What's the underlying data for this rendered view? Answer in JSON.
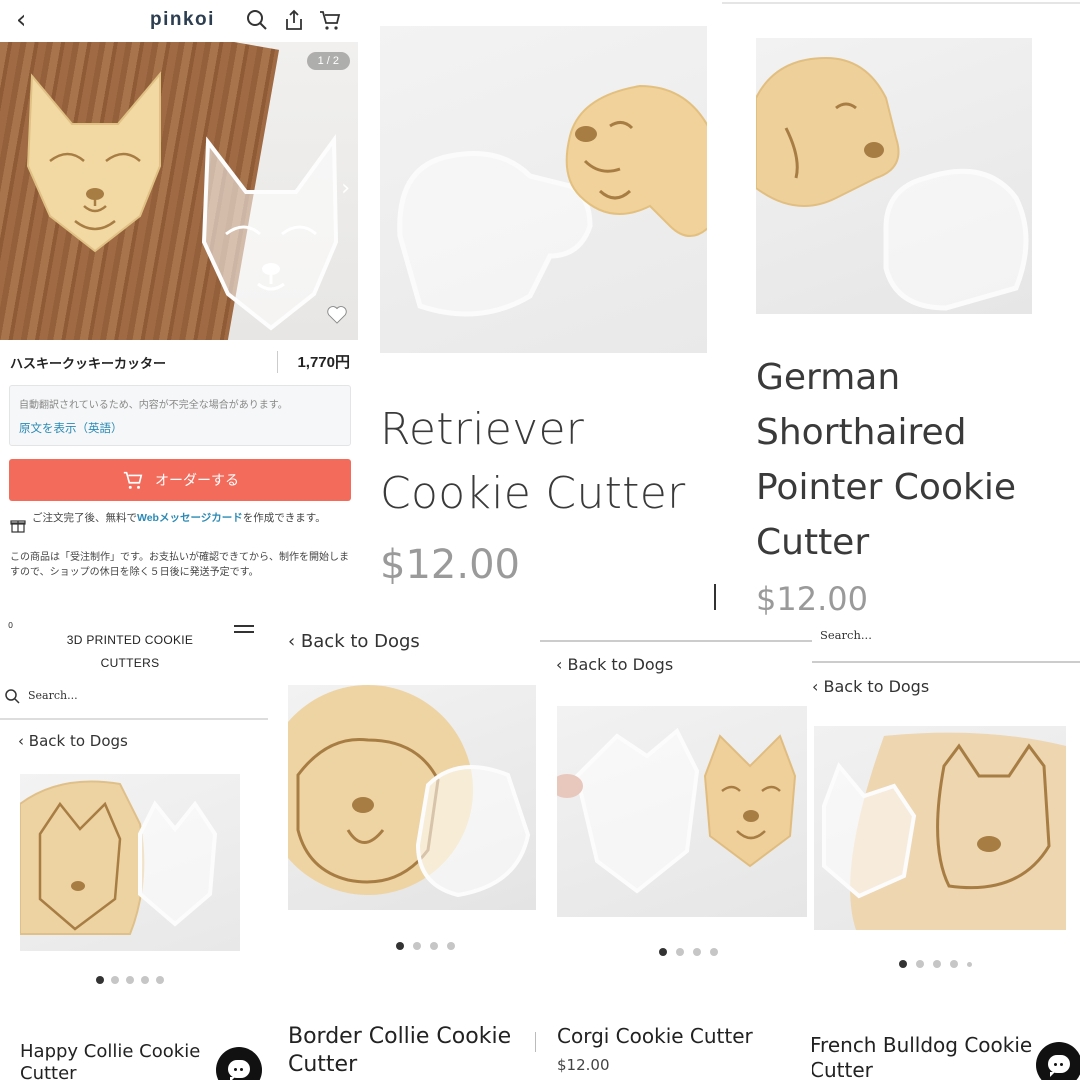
{
  "pinkoi": {
    "back_glyph": "‹",
    "logo": "pinkoi",
    "image_counter": "1 / 2",
    "product_title": "ハスキークッキーカッター",
    "price": "1,770円",
    "translation_note": "自動翻訳されているため、内容が不完全な場合があります。",
    "show_original_link": "原文を表示（英語）",
    "order_button": "オーダーする",
    "message_card_prefix": "ご注文完了後、無料で",
    "message_card_link": "Webメッセージカード",
    "message_card_suffix": "を作成できます。",
    "made_to_order_note": "この商品は「受注制作」です。お支払いが確認できてから、制作を開始しますので、ショップの休日を除く５日後に発送予定です。",
    "icons": [
      "back-icon",
      "search-icon",
      "share-icon",
      "cart-icon",
      "chevron-right-icon",
      "heart-icon",
      "gift-icon"
    ],
    "accent_color": "#f26b5b",
    "link_color": "#2a8ab5"
  },
  "retriever": {
    "title_line1": "Retriever",
    "title_line2": "Cookie Cutter",
    "price": "$12.00"
  },
  "pointer": {
    "title_line1": "German",
    "title_line2": "Shorthaired",
    "title_line3": "Pointer Cookie",
    "title_line4": "Cutter",
    "price": "$12.00"
  },
  "happy_collie": {
    "brand_line1": "3D PRINTED COOKIE",
    "brand_line2": "CUTTERS",
    "search_placeholder": "Search...",
    "back_link": "Back to Dogs",
    "title_line1": "Happy Collie Cookie",
    "title_line2": "Cutter",
    "dots_total": 5,
    "dots_active": 0
  },
  "border_collie": {
    "back_link": "Back to Dogs",
    "title_line1": "Border Collie Cookie",
    "title_line2": "Cutter",
    "dots_total": 4,
    "dots_active": 0
  },
  "corgi": {
    "back_link": "Back to Dogs",
    "title": "Corgi Cookie Cutter",
    "price": "$12.00",
    "dots_total": 4,
    "dots_active": 0
  },
  "french_bulldog": {
    "search_placeholder": "Search...",
    "back_link": "Back to Dogs",
    "title_line1": "French Bulldog Cookie",
    "title_line2": "Cutter",
    "dots_total": 5,
    "dots_active": 0
  }
}
